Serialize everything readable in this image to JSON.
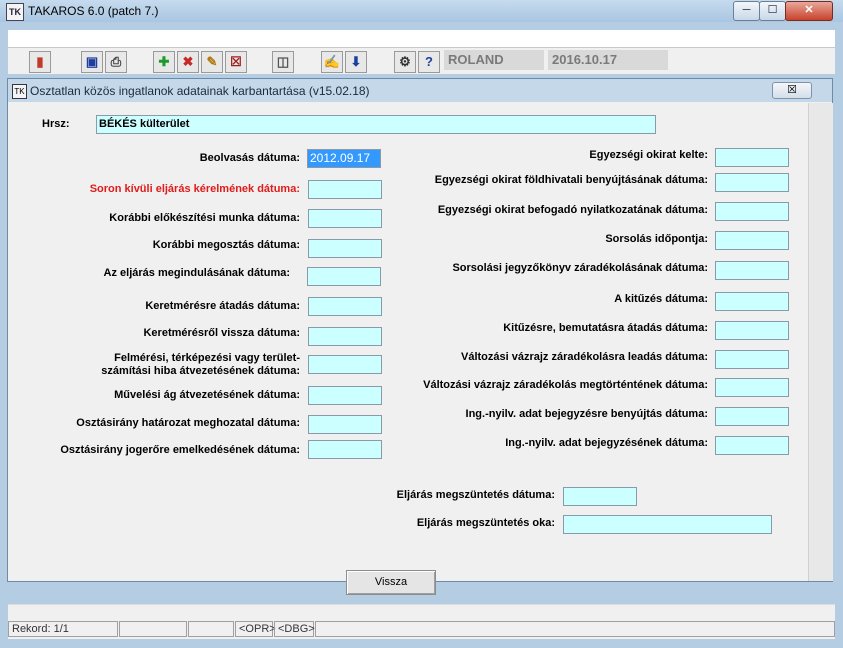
{
  "window": {
    "title": "TAKAROS 6.0 (patch 7.)",
    "icon_text": "TK"
  },
  "toolbar": {
    "user": "ROLAND",
    "date": "2016.10.17",
    "icons": [
      "exit-icon",
      "save-icon",
      "print-icon",
      "add-icon",
      "delete-icon",
      "edit-icon",
      "cancel-edit-icon",
      "database-icon",
      "notes-icon",
      "download-icon",
      "settings-icon",
      "help-icon"
    ]
  },
  "dialog": {
    "title": "Osztatlan közös ingatlanok adatainak karbantartása (v15.02.18)",
    "hrsz_label": "Hrsz:",
    "hrsz_value": "BÉKÉS külterület",
    "left_fields": [
      {
        "label": "Beolvasás dátuma:",
        "value": "2012.09.17"
      },
      {
        "label": "Soron kívüli eljárás kérelmének dátuma:",
        "value": ""
      },
      {
        "label": "Korábbi előkészítési munka dátuma:",
        "value": ""
      },
      {
        "label": "Korábbi megosztás dátuma:",
        "value": ""
      },
      {
        "label": "Az eljárás megindulásának dátuma:",
        "value": ""
      },
      {
        "label": "Keretmérésre átadás dátuma:",
        "value": ""
      },
      {
        "label": "Keretmérésről vissza dátuma:",
        "value": ""
      },
      {
        "label": "Felmérési, térképezési vagy terület-",
        "label2": "számítási hiba átvezetésének dátuma:",
        "value": ""
      },
      {
        "label": "Művelési ág átvezetésének dátuma:",
        "value": ""
      },
      {
        "label": "Osztásirány határozat meghozatal dátuma:",
        "value": ""
      },
      {
        "label": "Osztásirány jogerőre emelkedésének dátuma:",
        "value": ""
      }
    ],
    "right_fields": [
      {
        "label": "Egyezségi okirat kelte:",
        "value": ""
      },
      {
        "label": "Egyezségi okirat földhivatali benyújtásának dátuma:",
        "value": ""
      },
      {
        "label": "Egyezségi okirat befogadó nyilatkozatának dátuma:",
        "value": ""
      },
      {
        "label": "Sorsolás időpontja:",
        "value": ""
      },
      {
        "label": "Sorsolási jegyzőkönyv záradékolásának dátuma:",
        "value": ""
      },
      {
        "label": "A kitűzés dátuma:",
        "value": ""
      },
      {
        "label": "Kitűzésre, bemutatásra átadás dátuma:",
        "value": ""
      },
      {
        "label": "Változási vázrajz záradékolásra leadás dátuma:",
        "value": ""
      },
      {
        "label": "Változási vázrajz záradékolás megtörténtének dátuma:",
        "value": ""
      },
      {
        "label": "Ing.-nyilv. adat bejegyzésre benyújtás dátuma:",
        "value": ""
      },
      {
        "label": "Ing.-nyilv. adat bejegyzésének dátuma:",
        "value": ""
      }
    ],
    "termination_date_label": "Eljárás megszüntetés dátuma:",
    "termination_date_value": "",
    "termination_reason_label": "Eljárás megszüntetés oka:",
    "termination_reason_value": "",
    "back_button": "Vissza",
    "close_symbol": "☒"
  },
  "status": {
    "record": "Rekord: 1/1",
    "opr": "<OPR>",
    "dbg": "<DBG>"
  },
  "colors": {
    "field_bg": "#ccffff",
    "required_label": "#e01b1b",
    "selected": "#3399ff"
  }
}
